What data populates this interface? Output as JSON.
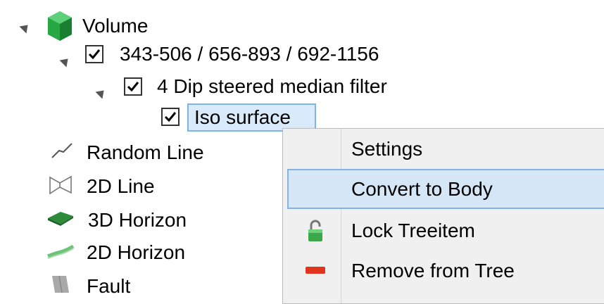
{
  "tree": {
    "volume_label": "Volume",
    "range_label": "343-506 / 656-893 / 692-1156",
    "filter_label": "4 Dip steered median filter",
    "iso_label": "Iso surface",
    "items": [
      {
        "label": "Random Line",
        "icon": "random-line-icon"
      },
      {
        "label": "2D Line",
        "icon": "2d-line-icon"
      },
      {
        "label": "3D Horizon",
        "icon": "3d-horizon-icon"
      },
      {
        "label": "2D Horizon",
        "icon": "2d-horizon-icon"
      },
      {
        "label": "Fault",
        "icon": "fault-icon"
      }
    ]
  },
  "context_menu": {
    "items": [
      {
        "label": "Settings",
        "icon": ""
      },
      {
        "label": "Convert to Body",
        "icon": "",
        "highlighted": true
      },
      {
        "label": "Lock Treeitem",
        "icon": "lock-icon"
      },
      {
        "label": "Remove from Tree",
        "icon": "remove-icon"
      }
    ]
  },
  "colors": {
    "volume_green": "#1f9a3b",
    "selection_bg": "#d9ebfb",
    "selection_border": "#7eb4ea",
    "menu_bg": "#f0f0f0",
    "menu_highlight": "#d5e6f6",
    "remove_red": "#e0341f"
  }
}
